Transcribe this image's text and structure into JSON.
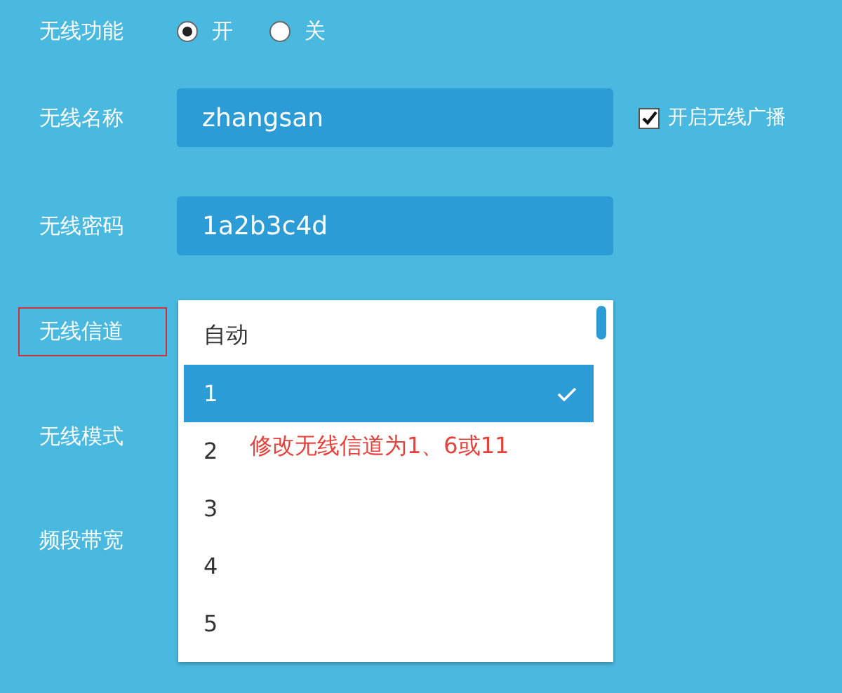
{
  "wireless_switch": {
    "label": "无线功能",
    "options": [
      {
        "label": "开",
        "selected": true
      },
      {
        "label": "关",
        "selected": false
      }
    ]
  },
  "ssid": {
    "label": "无线名称",
    "value": "zhangsan",
    "broadcast": {
      "label": "开启无线广播",
      "checked": true
    }
  },
  "password": {
    "label": "无线密码",
    "value": "1a2b3c4d"
  },
  "channel": {
    "label": "无线信道",
    "highlighted": true,
    "options": [
      {
        "label": "自动",
        "selected": false
      },
      {
        "label": "1",
        "selected": true
      },
      {
        "label": "2",
        "selected": false
      },
      {
        "label": "3",
        "selected": false
      },
      {
        "label": "4",
        "selected": false
      },
      {
        "label": "5",
        "selected": false
      }
    ]
  },
  "mode": {
    "label": "无线模式"
  },
  "bandwidth": {
    "label": "频段带宽"
  },
  "annotation": "修改无线信道为1、6或11"
}
